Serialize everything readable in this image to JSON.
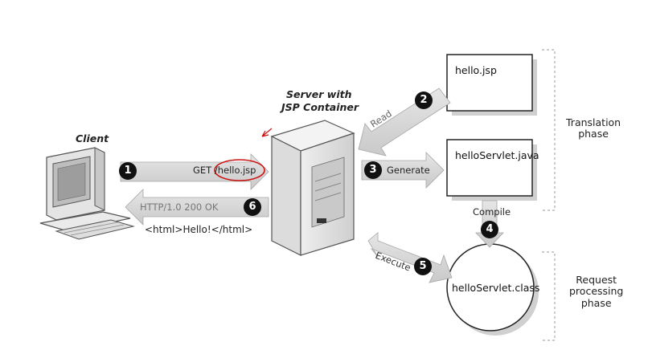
{
  "labels": {
    "client": "Client",
    "server_line1": "Server with",
    "server_line2": "JSP Container",
    "hello_jsp": "hello.jsp",
    "hello_servlet_java": "helloServlet.java",
    "hello_servlet_class": "helloServlet.class",
    "translation_phase": "Translation\nphase",
    "request_phase": "Request\nprocessing\nphase",
    "compile": "Compile"
  },
  "steps": [
    {
      "number": "1",
      "text": "GET /hello.jsp"
    },
    {
      "number": "2",
      "text": "Read"
    },
    {
      "number": "3",
      "text": "Generate"
    },
    {
      "number": "4",
      "text": ""
    },
    {
      "number": "5",
      "text": "Execute"
    },
    {
      "number": "6",
      "text": "HTTP/1.0 200 OK"
    }
  ],
  "response_body": "<html>Hello!</html>",
  "colors": {
    "arrow_fill": "#d9d9d9",
    "arrow_stroke": "#a6a6a6",
    "badge": "#111111",
    "highlight": "#cc1111"
  }
}
